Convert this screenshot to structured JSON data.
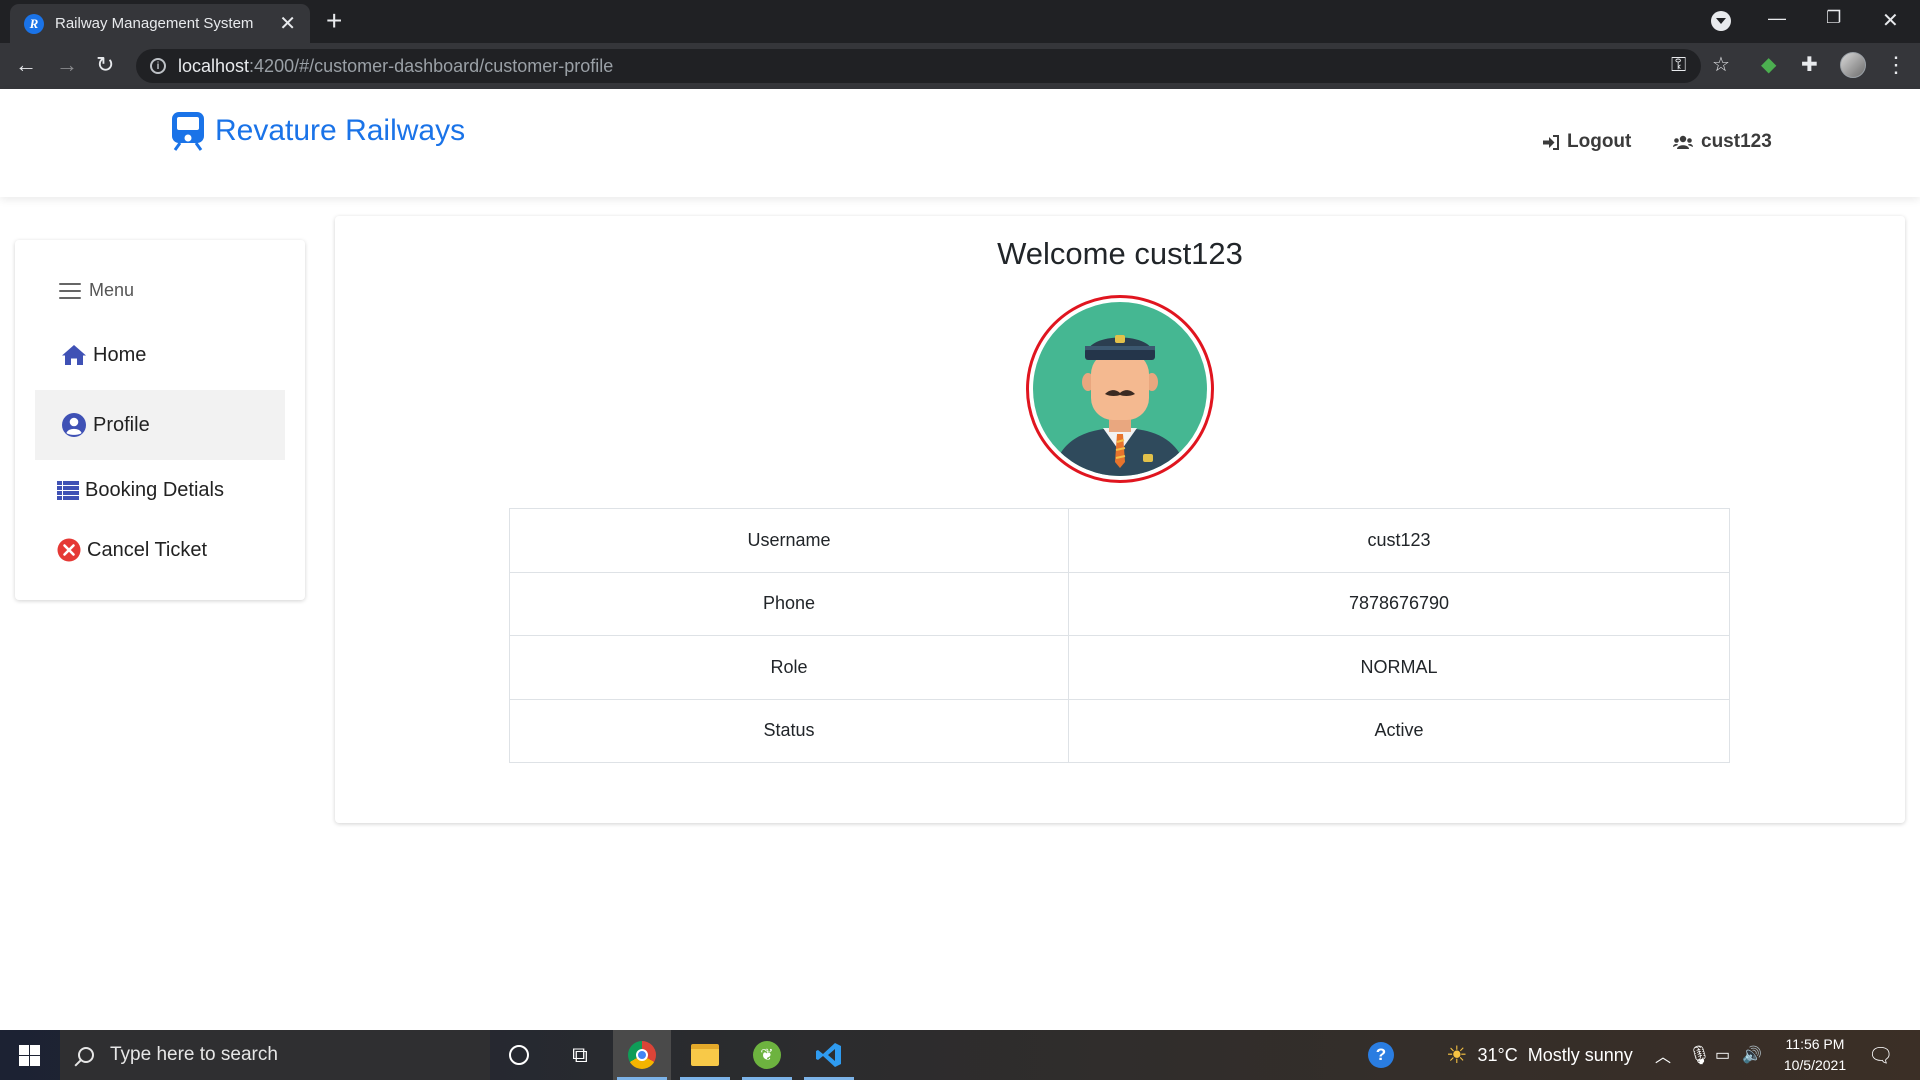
{
  "browser": {
    "tab_title": "Railway Management System",
    "url_host": "localhost",
    "url_path": ":4200/#/customer-dashboard/customer-profile"
  },
  "navbar": {
    "brand": "Revature Railways",
    "logout_label": "Logout",
    "user_label": "cust123"
  },
  "sidebar": {
    "menu_label": "Menu",
    "items": [
      {
        "label": "Home",
        "icon": "home-icon"
      },
      {
        "label": "Profile",
        "icon": "user-circle-icon",
        "active": true
      },
      {
        "label": "Booking Detials",
        "icon": "list-icon"
      },
      {
        "label": "Cancel Ticket",
        "icon": "cancel-circle-icon"
      }
    ]
  },
  "profile": {
    "welcome": "Welcome cust123",
    "rows": [
      {
        "key": "Username",
        "value": "cust123"
      },
      {
        "key": "Phone",
        "value": "7878676790"
      },
      {
        "key": "Role",
        "value": "NORMAL"
      },
      {
        "key": "Status",
        "value": "Active"
      }
    ]
  },
  "taskbar": {
    "search_placeholder": "Type here to search",
    "weather": "31°C  Mostly sunny",
    "time": "11:56 PM",
    "date": "10/5/2021"
  },
  "colors": {
    "brand_blue": "#1a73e8",
    "icon_indigo": "#3f51b5",
    "avatar_border": "#e0151f",
    "cancel_red": "#e53935"
  }
}
